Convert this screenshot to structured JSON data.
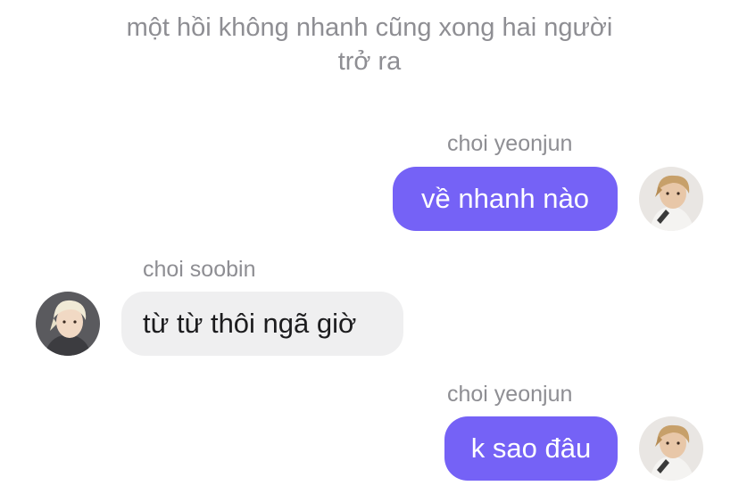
{
  "narration": {
    "line1": "một hồi không nhanh cũng xong hai người",
    "line2": "trở ra"
  },
  "messages": [
    {
      "sender": "choi yeonjun",
      "text": "về nhanh nào",
      "side": "right"
    },
    {
      "sender": "choi soobin",
      "text": "từ từ thôi ngã giờ",
      "side": "left"
    },
    {
      "sender": "choi yeonjun",
      "text": "k sao đâu",
      "side": "right"
    }
  ],
  "colors": {
    "sent_bubble": "#7562f6",
    "received_bubble": "#efeff0",
    "meta_text": "#8e8e93"
  }
}
